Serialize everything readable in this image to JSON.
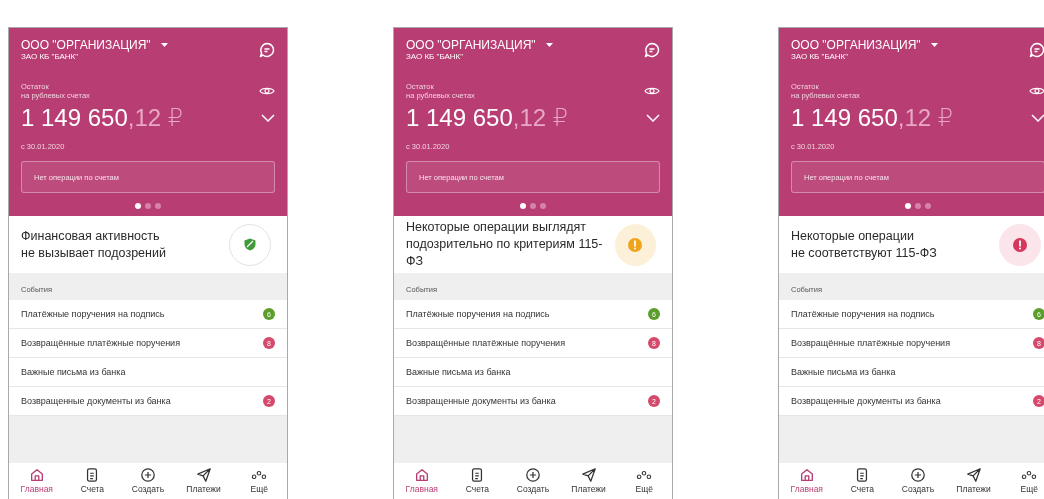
{
  "phones": [
    {
      "org": "ООО \"ОРГАНИЗАЦИЯ\"",
      "bank": "ЗАО КБ \"БАНК\"",
      "balance_label": "Остаток\nна рублевых счетах",
      "amount_main": "1 149 650",
      "amount_fraction": ",12 ₽",
      "date": "с 30.01.2020",
      "notice": "Нет операции по счетам",
      "pager": [
        {
          "selected": true
        },
        {
          "selected": false
        },
        {
          "selected": false
        }
      ],
      "status": {
        "kind": "ok",
        "text": "Финансовая активность\nне вызывает подозрений"
      },
      "events": {
        "title": "События",
        "items": [
          {
            "label": "Платёжные поручения на подпись",
            "badge": "6",
            "color": "#5b9e2c"
          },
          {
            "label": "Возвращённые платёжные поручения",
            "badge": "8",
            "color": "#d4496c"
          },
          {
            "label": "Важные письма из банка"
          },
          {
            "label": "Возвращенные документы из банка",
            "badge": "2",
            "color": "#d4496c"
          }
        ]
      },
      "nav": [
        {
          "label": "Главная",
          "selected": true
        },
        {
          "label": "Счета",
          "selected": false
        },
        {
          "label": "Создать",
          "selected": false
        },
        {
          "label": "Платежи",
          "selected": false
        },
        {
          "label": "Ещё",
          "selected": false
        }
      ]
    },
    {
      "org": "ООО \"ОРГАНИЗАЦИЯ\"",
      "bank": "ЗАО КБ \"БАНК\"",
      "balance_label": "Остаток\nна рублевых счетах",
      "amount_main": "1 149 650",
      "amount_fraction": ",12 ₽",
      "date": "с 30.01.2020",
      "notice": "Нет операции по счетам",
      "pager": [
        {
          "selected": true
        },
        {
          "selected": false
        },
        {
          "selected": false
        }
      ],
      "status": {
        "kind": "warning",
        "text": "Некоторые операции выглядят\nподозрительно по критериям 115-ФЗ"
      },
      "events": {
        "title": "События",
        "items": [
          {
            "label": "Платёжные поручения на подпись",
            "badge": "6",
            "color": "#5b9e2c"
          },
          {
            "label": "Возвращённые платёжные поручения",
            "badge": "8",
            "color": "#d4496c"
          },
          {
            "label": "Важные письма из банка"
          },
          {
            "label": "Возвращенные документы из банка",
            "badge": "2",
            "color": "#d4496c"
          }
        ]
      },
      "nav": [
        {
          "label": "Главная",
          "selected": true
        },
        {
          "label": "Счета",
          "selected": false
        },
        {
          "label": "Создать",
          "selected": false
        },
        {
          "label": "Платежи",
          "selected": false
        },
        {
          "label": "Ещё",
          "selected": false
        }
      ]
    },
    {
      "org": "ООО \"ОРГАНИЗАЦИЯ\"",
      "bank": "ЗАО КБ \"БАНК\"",
      "balance_label": "Остаток\nна рублевых счетах",
      "amount_main": "1 149 650",
      "amount_fraction": ",12 ₽",
      "date": "с 30.01.2020",
      "notice": "Нет операции по счетам",
      "pager": [
        {
          "selected": true
        },
        {
          "selected": false
        },
        {
          "selected": false
        }
      ],
      "status": {
        "kind": "alert",
        "text": "Некоторые операции\nне соответствуют 115-ФЗ"
      },
      "events": {
        "title": "События",
        "items": [
          {
            "label": "Платёжные поручения на подпись",
            "badge": "6",
            "color": "#5b9e2c"
          },
          {
            "label": "Возвращённые платёжные поручения",
            "badge": "8",
            "color": "#d4496c"
          },
          {
            "label": "Важные письма из банка"
          },
          {
            "label": "Возвращенные документы из банка",
            "badge": "2",
            "color": "#d4496c"
          }
        ]
      },
      "nav": [
        {
          "label": "Главная",
          "selected": true
        },
        {
          "label": "Счета",
          "selected": false
        },
        {
          "label": "Создать",
          "selected": false
        },
        {
          "label": "Платежи",
          "selected": false
        },
        {
          "label": "Ещё",
          "selected": false
        }
      ]
    }
  ]
}
